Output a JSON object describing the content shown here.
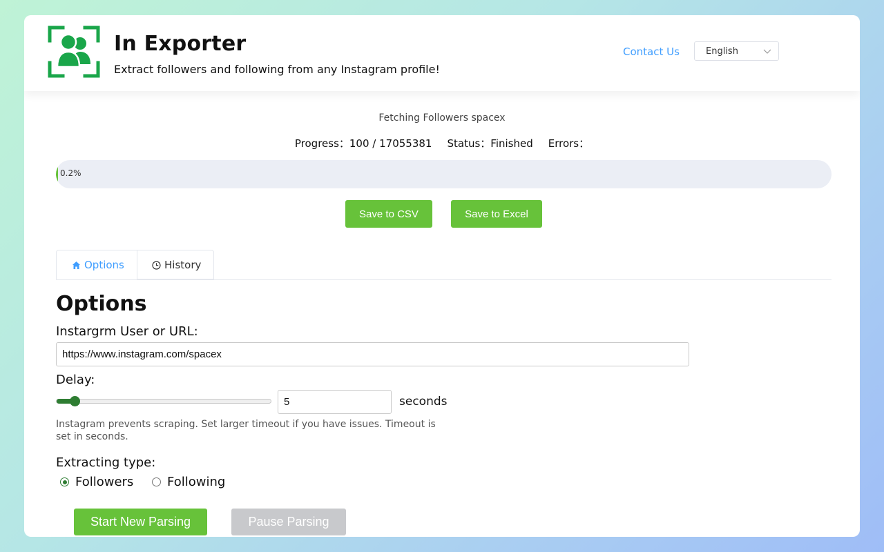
{
  "header": {
    "title": "In Exporter",
    "subtitle": "Extract followers and following from any Instagram profile!",
    "contact_label": "Contact Us",
    "language": "English"
  },
  "fetch": {
    "title": "Fetching Followers spacex",
    "progress_label": "Progress：",
    "progress_value": "100 / 17055381",
    "status_label": "Status：",
    "status_value": "Finished",
    "errors_label": "Errors：",
    "percent": 0.2,
    "percent_text": "0.2%"
  },
  "actions": {
    "save_csv": "Save to CSV",
    "save_excel": "Save to Excel"
  },
  "tabs": [
    {
      "label": "Options",
      "icon": "home-icon",
      "active": true
    },
    {
      "label": "History",
      "icon": "clock-icon",
      "active": false
    }
  ],
  "options": {
    "heading": "Options",
    "url_label": "Instargrm User or URL:",
    "url_value": "https://www.instagram.com/spacex",
    "delay_label": "Delay:",
    "delay_value": "5",
    "delay_min": 1,
    "delay_max": 60,
    "delay_unit": "seconds",
    "hint": "Instagram prevents scraping. Set larger timeout if you have issues. Timeout is set in seconds.",
    "type_label": "Extracting type:",
    "type_options": [
      {
        "label": "Followers",
        "selected": true
      },
      {
        "label": "Following",
        "selected": false
      }
    ]
  },
  "controls": {
    "start_label": "Start New Parsing",
    "pause_label": "Pause Parsing",
    "pause_disabled": true
  },
  "colors": {
    "brand_green": "#1aa64a",
    "button_green": "#67c23a",
    "link_blue": "#409eff",
    "slider_green": "#2e7d32",
    "disabled_gray": "#c8c9cc"
  }
}
